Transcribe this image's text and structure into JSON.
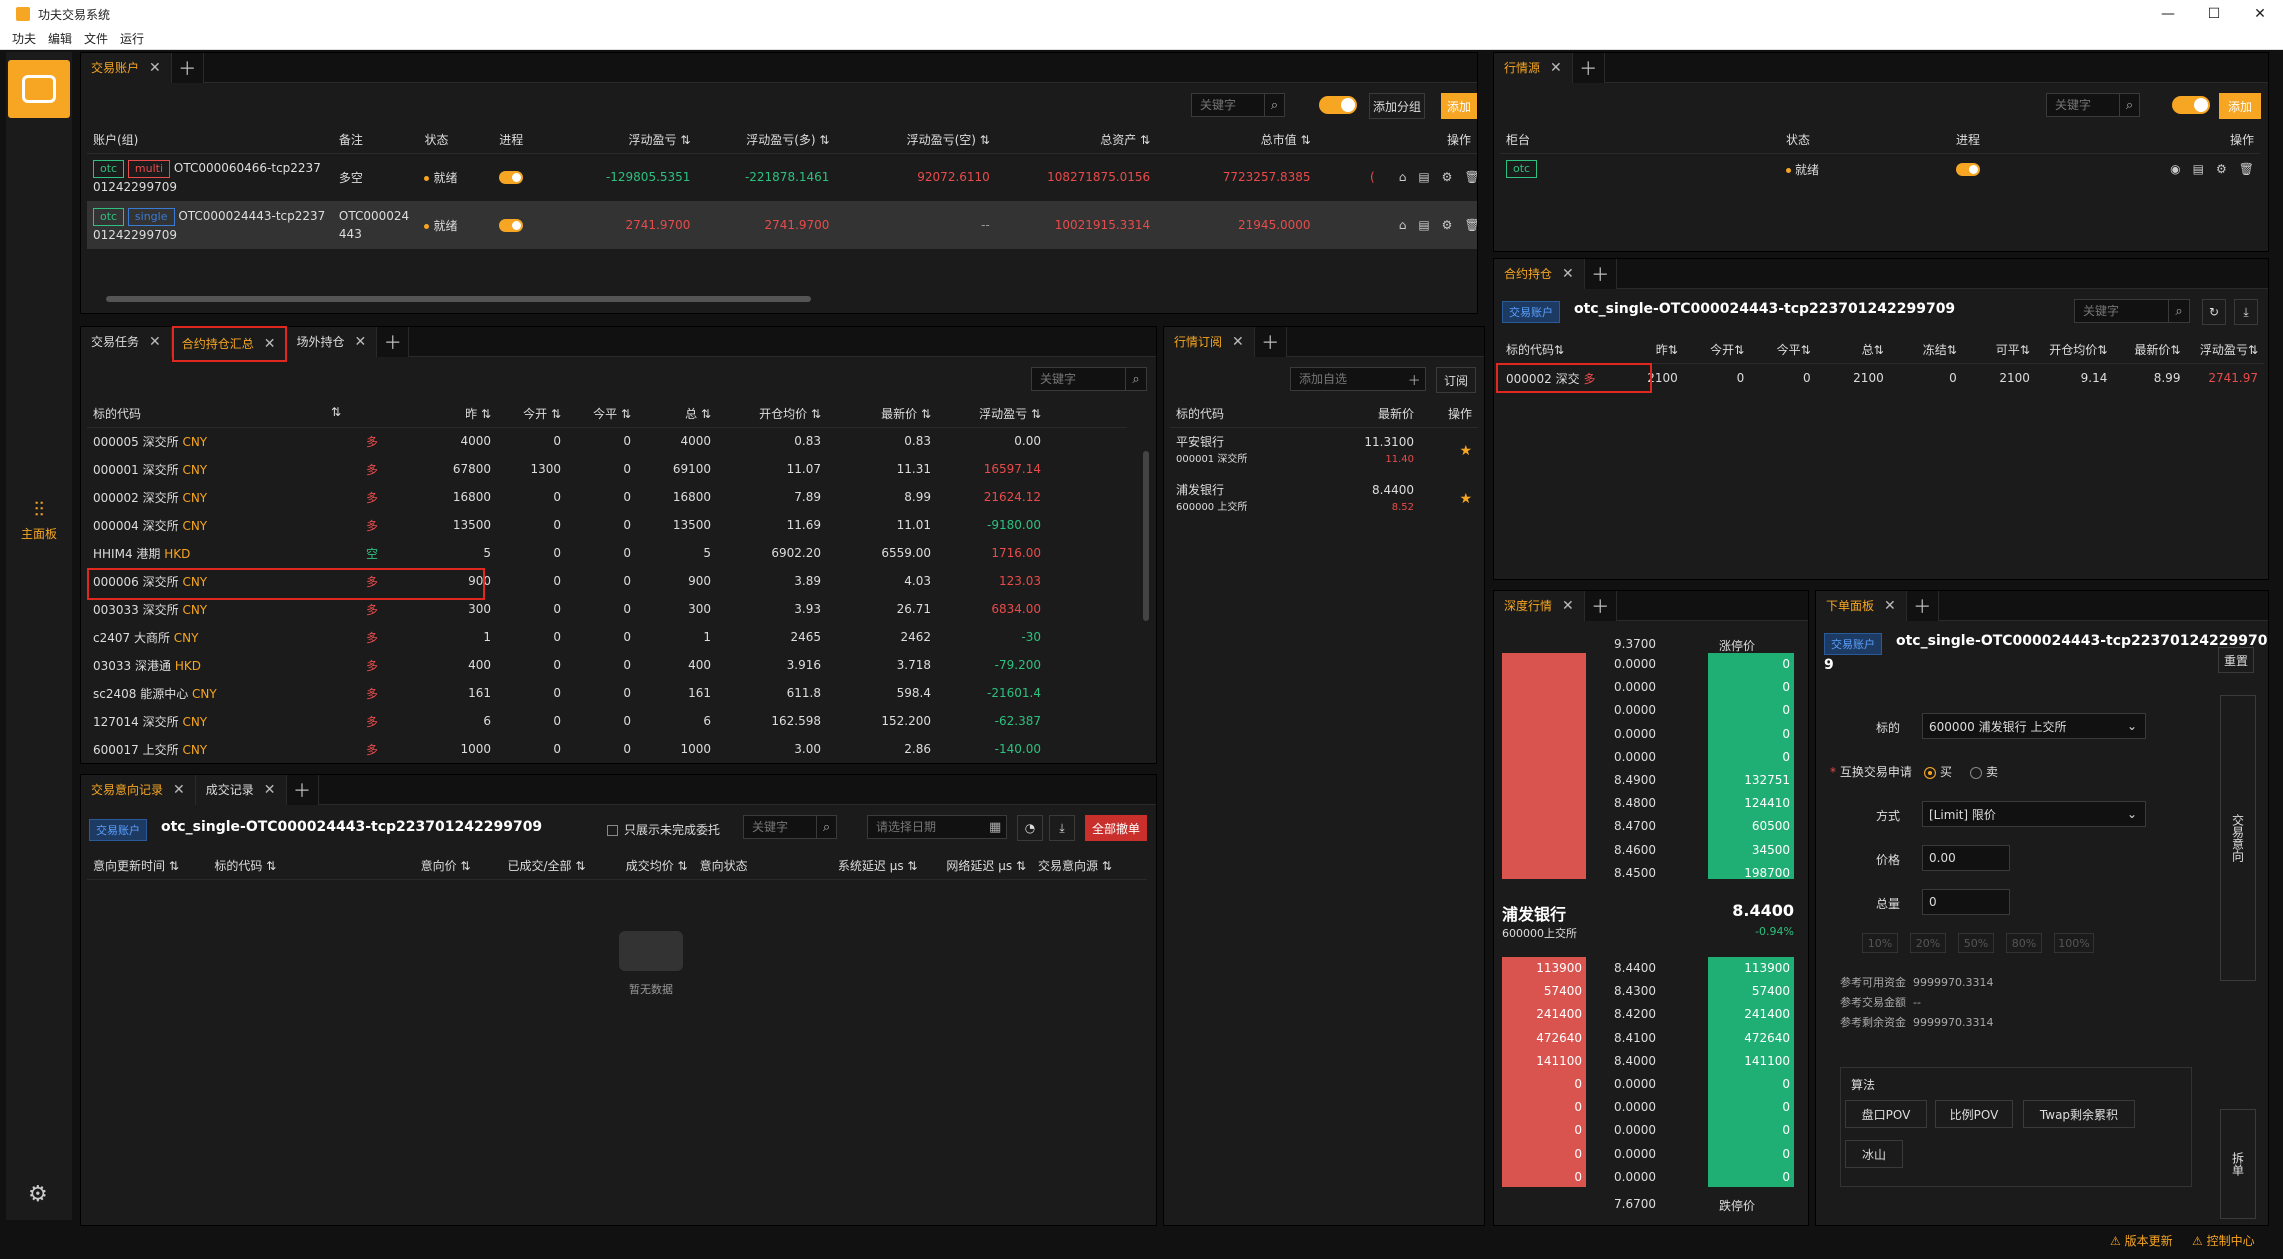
{
  "window": {
    "title": "功夫交易系统"
  },
  "menu": [
    "功夫",
    "编辑",
    "文件",
    "运行"
  ],
  "sidebar": {
    "main_label": "主面板"
  },
  "accounts_panel": {
    "tabs": [
      {
        "label": "交易账户"
      }
    ],
    "search_placeholder": "关键字",
    "add_group": "添加分组",
    "add": "添加",
    "columns": [
      "账户(组)",
      "备注",
      "状态",
      "进程",
      "浮动盈亏",
      "浮动盈亏(多)",
      "浮动盈亏(空)",
      "总资产",
      "总市值",
      "操作"
    ],
    "rows": [
      {
        "tags": [
          "otc",
          "multi"
        ],
        "account": "OTC000060466-tcp223701242299709",
        "note": "多空",
        "status": "就绪",
        "pnl": "-129805.5351",
        "pnl_long": "-221878.1461",
        "pnl_short": "92072.6110",
        "assets": "108271875.0156",
        "market": "7723257.8385"
      },
      {
        "tags": [
          "otc",
          "single"
        ],
        "account": "OTC000024443-tcp223701242299709",
        "note": "OTC000024443",
        "status": "就绪",
        "pnl": "2741.9700",
        "pnl_long": "2741.9700",
        "pnl_short": "--",
        "assets": "10021915.3314",
        "market": "21945.0000"
      }
    ]
  },
  "md_source_panel": {
    "tabs": [
      {
        "label": "行情源"
      }
    ],
    "search_placeholder": "关键字",
    "add": "添加",
    "columns": [
      "柜台",
      "状态",
      "进程",
      "操作"
    ],
    "rows": [
      {
        "tag": "otc",
        "status": "就绪"
      }
    ]
  },
  "positions_panel": {
    "tabs": [
      {
        "label": "交易任务"
      },
      {
        "label": "合约持仓汇总"
      },
      {
        "label": "场外持仓"
      }
    ],
    "search_placeholder": "关键字",
    "columns": [
      "标的代码",
      "",
      "昨",
      "今开",
      "今平",
      "总",
      "开仓均价",
      "最新价",
      "浮动盈亏"
    ],
    "rows": [
      {
        "code": "000005 深交所",
        "cur": "CNY",
        "dir": "多",
        "yd": "4000",
        "open": "0",
        "close": "0",
        "total": "4000",
        "avg": "0.83",
        "last": "0.83",
        "pnl": "0.00",
        "pc": "w"
      },
      {
        "code": "000001 深交所",
        "cur": "CNY",
        "dir": "多",
        "yd": "67800",
        "open": "1300",
        "close": "0",
        "total": "69100",
        "avg": "11.07",
        "last": "11.31",
        "pnl": "16597.14",
        "pc": "r"
      },
      {
        "code": "000002 深交所",
        "cur": "CNY",
        "dir": "多",
        "yd": "16800",
        "open": "0",
        "close": "0",
        "total": "16800",
        "avg": "7.89",
        "last": "8.99",
        "pnl": "21624.12",
        "pc": "r"
      },
      {
        "code": "000004 深交所",
        "cur": "CNY",
        "dir": "多",
        "yd": "13500",
        "open": "0",
        "close": "0",
        "total": "13500",
        "avg": "11.69",
        "last": "11.01",
        "pnl": "-9180.00",
        "pc": "g"
      },
      {
        "code": "HHIM4 港期",
        "cur": "HKD",
        "dir": "空",
        "yd": "5",
        "open": "0",
        "close": "0",
        "total": "5",
        "avg": "6902.20",
        "last": "6559.00",
        "pnl": "1716.00",
        "pc": "r"
      },
      {
        "code": "000006 深交所",
        "cur": "CNY",
        "dir": "多",
        "yd": "900",
        "open": "0",
        "close": "0",
        "total": "900",
        "avg": "3.89",
        "last": "4.03",
        "pnl": "123.03",
        "pc": "r"
      },
      {
        "code": "003033 深交所",
        "cur": "CNY",
        "dir": "多",
        "yd": "300",
        "open": "0",
        "close": "0",
        "total": "300",
        "avg": "3.93",
        "last": "26.71",
        "pnl": "6834.00",
        "pc": "r"
      },
      {
        "code": "c2407 大商所",
        "cur": "CNY",
        "dir": "多",
        "yd": "1",
        "open": "0",
        "close": "0",
        "total": "1",
        "avg": "2465",
        "last": "2462",
        "pnl": "-30",
        "pc": "g"
      },
      {
        "code": "03033 深港通",
        "cur": "HKD",
        "dir": "多",
        "yd": "400",
        "open": "0",
        "close": "0",
        "total": "400",
        "avg": "3.916",
        "last": "3.718",
        "pnl": "-79.200",
        "pc": "g"
      },
      {
        "code": "sc2408 能源中心",
        "cur": "CNY",
        "dir": "多",
        "yd": "161",
        "open": "0",
        "close": "0",
        "total": "161",
        "avg": "611.8",
        "last": "598.4",
        "pnl": "-21601.4",
        "pc": "g"
      },
      {
        "code": "127014 深交所",
        "cur": "CNY",
        "dir": "多",
        "yd": "6",
        "open": "0",
        "close": "0",
        "total": "6",
        "avg": "162.598",
        "last": "152.200",
        "pnl": "-62.387",
        "pc": "g"
      },
      {
        "code": "600017 上交所",
        "cur": "CNY",
        "dir": "多",
        "yd": "1000",
        "open": "0",
        "close": "0",
        "total": "1000",
        "avg": "3.00",
        "last": "2.86",
        "pnl": "-140.00",
        "pc": "g"
      }
    ]
  },
  "subscribe_panel": {
    "tabs": [
      {
        "label": "行情订阅"
      }
    ],
    "placeholder": "添加自选",
    "subscribe": "订阅",
    "columns": [
      "标的代码",
      "最新价",
      "操作"
    ],
    "rows": [
      {
        "name": "平安银行",
        "code": "000001 深交所",
        "price": "11.3100",
        "sub": "11.40"
      },
      {
        "name": "浦发银行",
        "code": "600000 上交所",
        "price": "8.4400",
        "sub": "8.52"
      }
    ]
  },
  "orders_panel": {
    "tabs": [
      {
        "label": "交易意向记录"
      },
      {
        "label": "成交记录"
      }
    ],
    "badge": "交易账户",
    "account": "otc_single-OTC000024443-tcp223701242299709",
    "only_unfinished": "只展示未完成委托",
    "search_placeholder": "关键字",
    "date_placeholder": "请选择日期",
    "cancel_all": "全部撤单",
    "columns": [
      "意向更新时间",
      "标的代码",
      "",
      "意向价",
      "已成交/全部",
      "成交均价",
      "意向状态",
      "系统延迟 μs",
      "网络延迟 μs",
      "交易意向源"
    ],
    "empty": "暂无数据"
  },
  "contract_panel": {
    "tabs": [
      {
        "label": "合约持仓"
      }
    ],
    "badge": "交易账户",
    "account": "otc_single-OTC000024443-tcp223701242299709",
    "search_placeholder": "关键字",
    "columns": [
      "标的代码",
      "",
      "昨",
      "今开",
      "今平",
      "总",
      "冻结",
      "可平",
      "开仓均价",
      "最新价",
      "浮动盈亏"
    ],
    "rows": [
      {
        "code": "000002 深交",
        "dir": "多",
        "yd": "2100",
        "open": "0",
        "close": "0",
        "total": "2100",
        "frozen": "0",
        "avail": "2100",
        "avg": "9.14",
        "last": "8.99",
        "pnl": "2741.97"
      }
    ]
  },
  "depth_panel": {
    "tabs": [
      {
        "label": "深度行情"
      }
    ],
    "limit_up_price": "9.3700",
    "limit_up_label": "涨停价",
    "asks": [
      {
        "p": "0.0000",
        "v": "0"
      },
      {
        "p": "0.0000",
        "v": "0"
      },
      {
        "p": "0.0000",
        "v": "0"
      },
      {
        "p": "0.0000",
        "v": "0"
      },
      {
        "p": "0.0000",
        "v": "0"
      },
      {
        "p": "8.4900",
        "v": "132751"
      },
      {
        "p": "8.4800",
        "v": "124410"
      },
      {
        "p": "8.4700",
        "v": "60500"
      },
      {
        "p": "8.4600",
        "v": "34500"
      },
      {
        "p": "8.4500",
        "v": "198700"
      }
    ],
    "name": "浦发银行",
    "code": "600000上交所",
    "price": "8.4400",
    "change": "-0.94%",
    "bids": [
      {
        "p": "8.4400",
        "v": "113900"
      },
      {
        "p": "8.4300",
        "v": "57400"
      },
      {
        "p": "8.4200",
        "v": "241400"
      },
      {
        "p": "8.4100",
        "v": "472640"
      },
      {
        "p": "8.4000",
        "v": "141100"
      },
      {
        "p": "0.0000",
        "v": "0"
      },
      {
        "p": "0.0000",
        "v": "0"
      },
      {
        "p": "0.0000",
        "v": "0"
      },
      {
        "p": "0.0000",
        "v": "0"
      },
      {
        "p": "0.0000",
        "v": "0"
      }
    ],
    "limit_down_price": "7.6700",
    "limit_down_label": "跌停价"
  },
  "order_panel": {
    "tabs": [
      {
        "label": "下单面板"
      }
    ],
    "badge": "交易账户",
    "account": "otc_single-OTC000024443-tcp22370124229970",
    "account_tail": "9",
    "reset": "重置",
    "instrument_label": "标的",
    "instrument_value": "600000 浦发银行 上交所",
    "side_label": "互换交易申请",
    "buy": "买",
    "sell": "卖",
    "mode_label": "方式",
    "mode_value": "[Limit] 限价",
    "price_label": "价格",
    "price_value": "0.00",
    "qty_label": "总量",
    "qty_value": "0",
    "pcts": [
      "10%",
      "20%",
      "50%",
      "80%",
      "100%"
    ],
    "ref_avail_label": "参考可用资金",
    "ref_avail": "9999970.3314",
    "ref_amount_label": "参考交易金额",
    "ref_amount": "--",
    "ref_left_label": "参考剩余资金",
    "ref_left": "9999970.3314",
    "algo_label": "算法",
    "algos": [
      "盘口POV",
      "比例POV",
      "Twap剩余累积",
      "冰山"
    ],
    "trade_intent": "交易意向",
    "split": "拆单"
  },
  "statusbar": {
    "update": "版本更新",
    "control": "控制中心"
  },
  "colors": {
    "accent": "#f6a623",
    "up": "#e84b4b",
    "down": "#2ec07f",
    "bg": "#1b1b1b"
  }
}
